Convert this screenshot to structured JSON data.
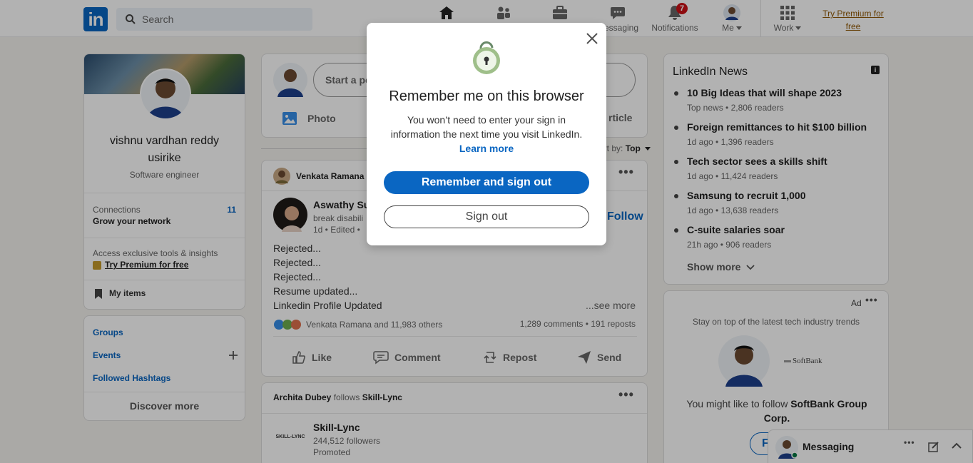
{
  "nav": {
    "logo_text": "in",
    "search_placeholder": "Search",
    "items": [
      {
        "label": "",
        "icon": "home-icon"
      },
      {
        "label": "",
        "icon": "network-icon"
      },
      {
        "label": "",
        "icon": "jobs-icon"
      },
      {
        "label": "Messaging",
        "icon": "messaging-icon"
      },
      {
        "label": "Notifications",
        "icon": "bell-icon",
        "badge": "7"
      },
      {
        "label": "Me",
        "icon": "avatar"
      },
      {
        "label": "Work",
        "icon": "grid-icon"
      }
    ],
    "premium_link": "Try Premium for free"
  },
  "profile": {
    "name": "vishnu vardhan reddy usirike",
    "title": "Software engineer",
    "connections_label": "Connections",
    "connections_sub": "Grow your network",
    "connections_count": "11",
    "premium_prompt": "Access exclusive tools & insights",
    "premium_link": "Try Premium for free",
    "my_items": "My items"
  },
  "left_links": {
    "groups": "Groups",
    "events": "Events",
    "hashtags": "Followed Hashtags",
    "discover": "Discover more"
  },
  "composer": {
    "placeholder": "Start a post",
    "photo": "Photo",
    "article_partial": "rticle"
  },
  "sort": {
    "label": "Sort by:",
    "value": "Top"
  },
  "post1": {
    "activity_actor": "Venkata Ramana",
    "activity_partial": "li",
    "author_partial": "Aswathy Su",
    "headline_partial": "break disabili",
    "meta_partial": "1d • Edited •",
    "follow_partial": "Follow",
    "lines": [
      "Rejected...",
      "Rejected...",
      "Rejected...",
      "Resume updated...",
      "Linkedin Profile Updated"
    ],
    "see_more": "...see more",
    "reactions": "Venkata Ramana and 11,983 others",
    "stats": "1,289 comments • 191 reposts",
    "actions": [
      "Like",
      "Comment",
      "Repost",
      "Send"
    ]
  },
  "post2": {
    "actor": "Archita Dubey",
    "verb": "follows",
    "target": "Skill-Lync",
    "company": "Skill-Lync",
    "logo_text": "SKILL-LYNC",
    "followers": "244,512 followers",
    "promoted": "Promoted"
  },
  "news": {
    "title": "LinkedIn News",
    "items": [
      {
        "title": "10 Big Ideas that will shape 2023",
        "meta": "Top news • 2,806 readers"
      },
      {
        "title": "Foreign remittances to hit $100 billion",
        "meta": "1d ago • 1,396 readers"
      },
      {
        "title": "Tech sector sees a skills shift",
        "meta": "1d ago • 11,424 readers"
      },
      {
        "title": "Samsung to recruit 1,000",
        "meta": "1d ago • 13,638 readers"
      },
      {
        "title": "C-suite salaries soar",
        "meta": "21h ago • 906 readers"
      }
    ],
    "show_more": "Show more"
  },
  "ad": {
    "label": "Ad",
    "tagline": "Stay on top of the latest tech industry trends",
    "company_logo": "SoftBank",
    "follow_prompt_prefix": "You might like to follow",
    "company": "SoftBank Group Corp.",
    "follow_partial": "F"
  },
  "messaging": {
    "label": "Messaging"
  },
  "modal": {
    "title": "Remember me on this browser",
    "description": "You won’t need to enter your sign in information the next time you visit LinkedIn.",
    "learn_more": "Learn more",
    "primary": "Remember and sign out",
    "secondary": "Sign out"
  },
  "colors": {
    "brand": "#0a66c2",
    "premium": "#915907",
    "badge": "#cc1016"
  }
}
